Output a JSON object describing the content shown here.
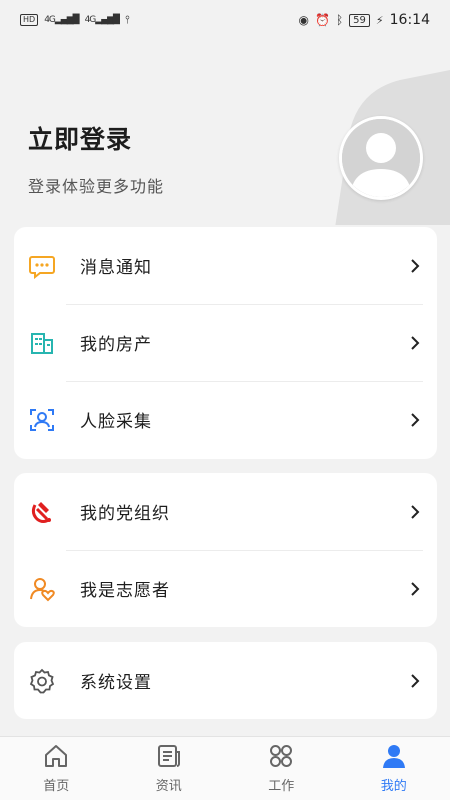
{
  "status_bar": {
    "left_items": [
      "HD",
      "4G",
      "4G",
      "USB"
    ],
    "battery": "59",
    "time": "16:14"
  },
  "header": {
    "title": "立即登录",
    "subtitle": "登录体验更多功能"
  },
  "menu_groups": [
    [
      {
        "label": "消息通知",
        "icon": "message-icon"
      },
      {
        "label": "我的房产",
        "icon": "building-icon"
      },
      {
        "label": "人脸采集",
        "icon": "face-scan-icon"
      }
    ],
    [
      {
        "label": "我的党组织",
        "icon": "party-emblem-icon"
      },
      {
        "label": "我是志愿者",
        "icon": "volunteer-heart-icon"
      }
    ],
    [
      {
        "label": "系统设置",
        "icon": "gear-icon"
      }
    ]
  ],
  "tabbar": {
    "tabs": [
      {
        "label": "首页",
        "icon": "home-icon",
        "active": false
      },
      {
        "label": "资讯",
        "icon": "news-icon",
        "active": false
      },
      {
        "label": "工作",
        "icon": "work-grid-icon",
        "active": false
      },
      {
        "label": "我的",
        "icon": "person-icon",
        "active": true
      }
    ]
  },
  "colors": {
    "accent": "#2f7af5",
    "message_icon": "#f5a623",
    "building_icon": "#27b5b0",
    "face_icon": "#2f7af5",
    "party_icon": "#e02020",
    "volunteer_icon": "#f08a24",
    "gear_icon": "#555555"
  }
}
